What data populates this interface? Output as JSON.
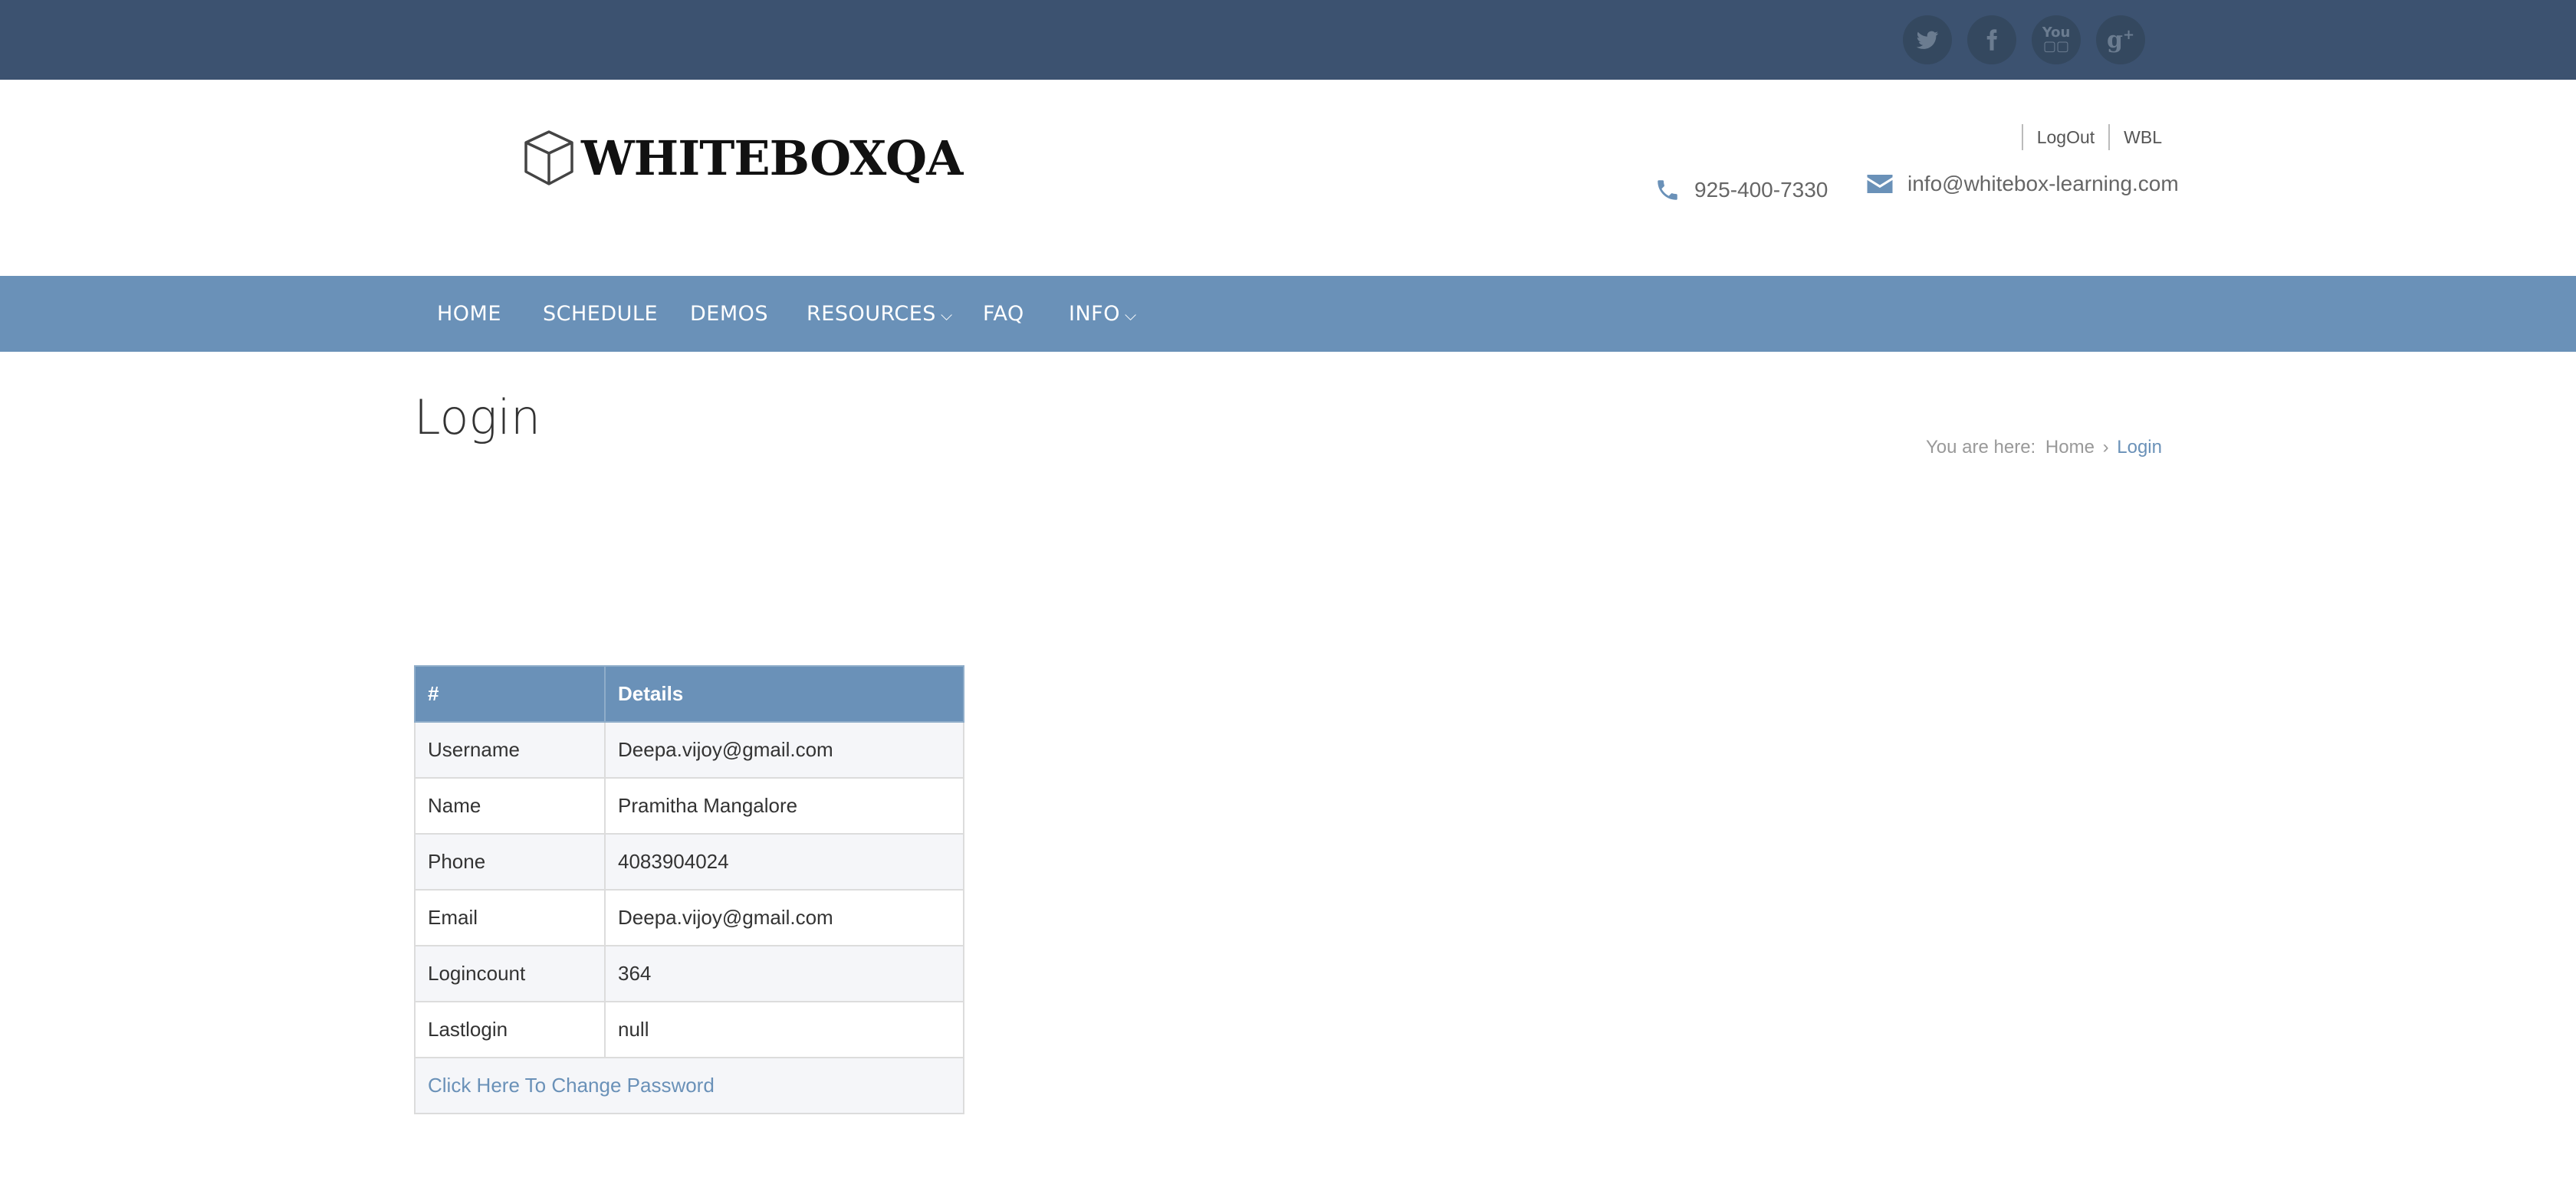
{
  "social": [
    {
      "icon": "twitter-icon",
      "glyph": "t"
    },
    {
      "icon": "facebook-icon",
      "glyph": "f"
    },
    {
      "icon": "youtube-icon",
      "glyph": "You"
    },
    {
      "icon": "google-plus-icon",
      "glyph": "g+"
    }
  ],
  "header": {
    "logo_text": "WHITEBOXQA",
    "links": [
      "LogOut",
      "WBL"
    ],
    "phone": "925-400-7330",
    "email": "info@whitebox-learning.com"
  },
  "nav": [
    {
      "label": "HOME"
    },
    {
      "label": "SCHEDULE"
    },
    {
      "label": "DEMOS"
    },
    {
      "label": "RESOURCES",
      "dropdown": true
    },
    {
      "label": "FAQ"
    },
    {
      "label": "INFO",
      "dropdown": true
    }
  ],
  "page": {
    "title": "Login",
    "breadcrumb": {
      "prefix": "You are here:",
      "home": "Home",
      "current": "Login"
    }
  },
  "table": {
    "headers": [
      "#",
      "Details"
    ],
    "rows": [
      [
        "Username",
        "Deepa.vijoy@gmail.com"
      ],
      [
        "Name",
        "Pramitha Mangalore"
      ],
      [
        "Phone",
        "4083904024"
      ],
      [
        "Email",
        "Deepa.vijoy@gmail.com"
      ],
      [
        "Logincount",
        "364"
      ],
      [
        "Lastlogin",
        "null"
      ]
    ],
    "footer_link": "Click Here To Change Password"
  },
  "colors": {
    "topbar": "#3c5270",
    "nav": "#6a91b8",
    "accent": "#6a91b8"
  }
}
